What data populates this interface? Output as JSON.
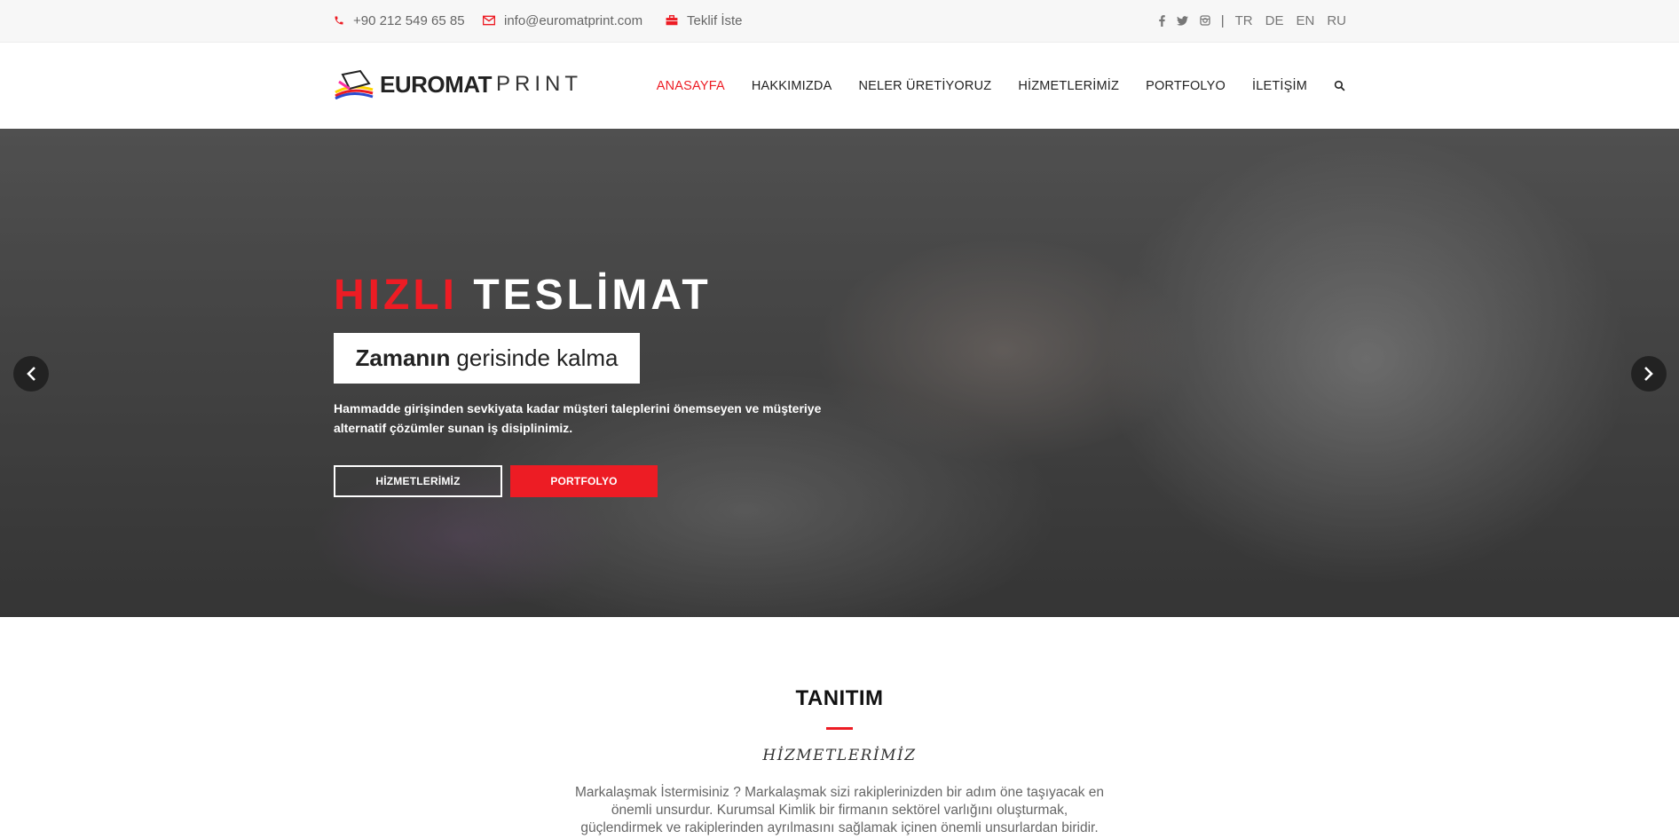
{
  "topbar": {
    "phone": "+90 212 549 65 85",
    "email": "info@euromatprint.com",
    "quote": "Teklif İste",
    "separator": "|",
    "languages": [
      "TR",
      "DE",
      "EN",
      "RU"
    ]
  },
  "header": {
    "logo_brand": "EUROMAT",
    "logo_print": "PRINT",
    "nav": [
      "ANASAYFA",
      "HAKKIMIZDA",
      "NELER ÜRETİYORUZ",
      "HİZMETLERİMİZ",
      "PORTFOLYO",
      "İLETİŞİM"
    ]
  },
  "hero": {
    "title_red": "HIZLI",
    "title_white": "TESLİMAT",
    "subtitle_bold": "Zamanın",
    "subtitle_rest": "gerisinde kalma",
    "description": "Hammadde girişinden sevkiyata kadar müşteri taleplerini önemseyen ve müşteriye alternatif çözümler sunan iş disiplinimiz.",
    "button_services": "HİZMETLERİMİZ",
    "button_portfolio": "PORTFOLYO"
  },
  "intro": {
    "title": "TANITIM",
    "script_title": "HİZMETLERİMİZ",
    "text": "Markalaşmak İstermisiniz ? Markalaşmak sizi rakiplerinizden bir adım öne taşıyacak en önemli unsurdur. Kurumsal Kimlik bir firmanın sektörel varlığını oluşturmak, güçlendirmek ve rakiplerinden ayrılmasını sağlamak içinen önemli unsurlardan biridir. Kimlik için doğru"
  },
  "colors": {
    "accent": "#ed1c24",
    "dark": "#222222",
    "muted": "#666666"
  },
  "icons": [
    "phone-icon",
    "mail-icon",
    "briefcase-icon",
    "facebook-icon",
    "twitter-icon",
    "instagram-icon",
    "search-icon",
    "chevron-left-icon",
    "chevron-right-icon"
  ]
}
